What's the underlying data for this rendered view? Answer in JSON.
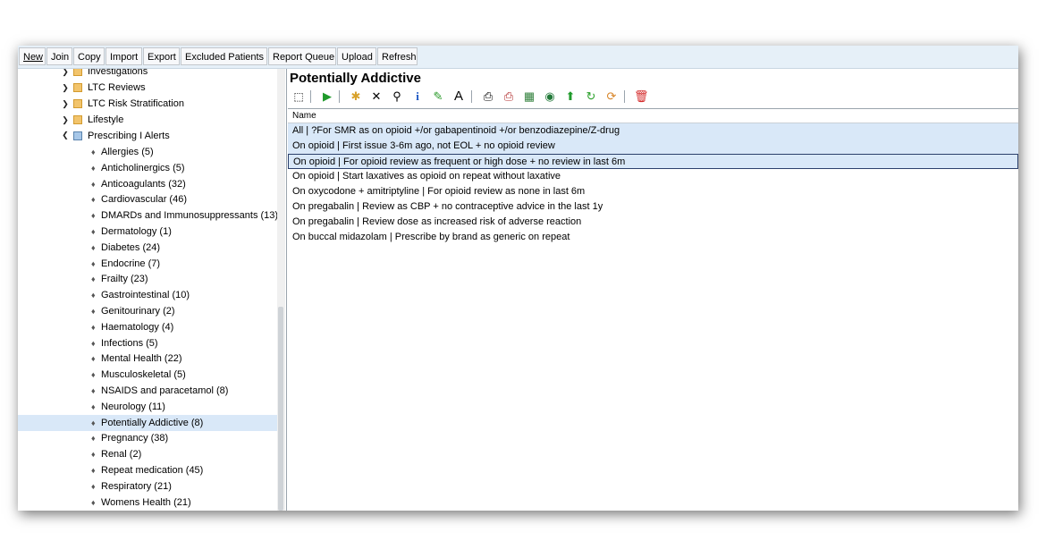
{
  "toolbar": {
    "buttons": [
      "New",
      "Join",
      "Copy",
      "Import",
      "Export",
      "Excluded Patients",
      "Report Queue",
      "Upload",
      "Refresh"
    ]
  },
  "tree": {
    "folders": [
      {
        "label": "Investigations",
        "state": "expanded"
      },
      {
        "label": "LTC Reviews",
        "state": "expanded"
      },
      {
        "label": "LTC Risk Stratification",
        "state": "expanded"
      },
      {
        "label": "Lifestyle",
        "state": "expanded"
      },
      {
        "label": "Prescribing I Alerts",
        "state": "collapsed-open"
      }
    ],
    "items": [
      "Allergies (5)",
      "Anticholinergics (5)",
      "Anticoagulants (32)",
      "Cardiovascular (46)",
      "DMARDs and Immunosuppressants (13)",
      "Dermatology (1)",
      "Diabetes (24)",
      "Endocrine (7)",
      "Frailty (23)",
      "Gastrointestinal (10)",
      "Genitourinary (2)",
      "Haematology (4)",
      "Infections (5)",
      "Mental Health (22)",
      "Musculoskeletal (5)",
      "NSAIDS and paracetamol (8)",
      "Neurology (11)",
      "Potentially Addictive (8)",
      "Pregnancy (38)",
      "Renal (2)",
      "Repeat medication (45)",
      "Respiratory (21)",
      "Womens Health (21)"
    ],
    "selected": "Potentially Addictive (8)"
  },
  "panel": {
    "title": "Potentially Addictive",
    "icons": [
      "select-icon",
      "run-icon",
      "add-icon",
      "delete-icon",
      "search-icon",
      "info-icon",
      "edit-icon",
      "font-icon",
      "print-icon",
      "print-preview-icon",
      "export-icon",
      "view-icon",
      "move-up-icon",
      "refresh-icon",
      "refresh-all-icon",
      "trash-icon"
    ],
    "column_header": "Name",
    "rows": [
      "All | ?For SMR as on opioid +/or gabapentinoid +/or benzodiazepine/Z-drug",
      "On opioid | First issue 3-6m ago, not EOL + no opioid review",
      "On opioid | For opioid review as frequent or high dose + no review in last 6m",
      "On opioid | Start laxatives as opioid on repeat without laxative",
      "On oxycodone + amitriptyline | For opioid review as none in last 6m",
      "On pregabalin | Review as CBP + no contraceptive advice in the last 1y",
      "On pregabalin | Review dose as increased risk of adverse reaction",
      "On buccal midazolam | Prescribe by brand as generic on repeat"
    ]
  },
  "colors": {
    "toolbar_bg": "#e6f0f8",
    "selection": "#d9e8f8",
    "focus_border": "#2b3f6b"
  }
}
